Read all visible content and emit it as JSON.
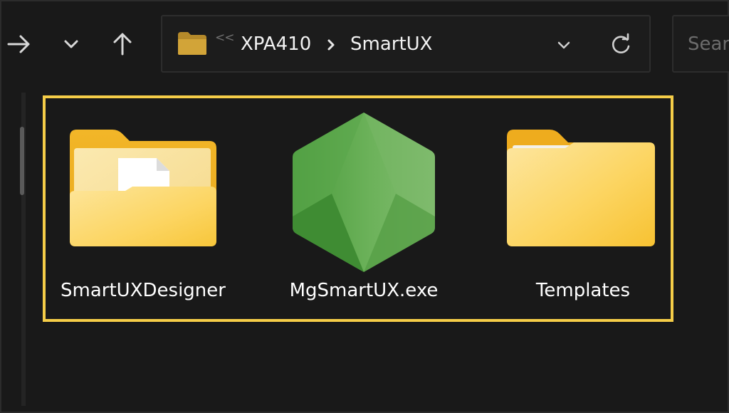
{
  "toolbar": {
    "forward_icon": "forward-arrow-icon",
    "recent_icon": "chevron-down-icon",
    "up_icon": "up-arrow-icon"
  },
  "address_bar": {
    "location_icon": "folder-icon",
    "overflow_glyph": "<<",
    "breadcrumbs": [
      {
        "label": "XPA410"
      },
      {
        "label": "SmartUX"
      }
    ],
    "separator_icon": "chevron-right-icon",
    "dropdown_icon": "chevron-down-icon",
    "refresh_icon": "refresh-icon"
  },
  "search": {
    "placeholder": "Search"
  },
  "files": [
    {
      "name": "SmartUXDesigner",
      "icon": "folder-with-document-icon"
    },
    {
      "name": "MgSmartUX.exe",
      "icon": "nodejs-hexagon-icon"
    },
    {
      "name": "Templates",
      "icon": "folder-icon"
    }
  ],
  "colors": {
    "background": "#191919",
    "selection_highlight": "#f5cd48",
    "folder_yellow": "#fcd562",
    "node_green": "#5fa04e",
    "text": "#ffffff"
  }
}
